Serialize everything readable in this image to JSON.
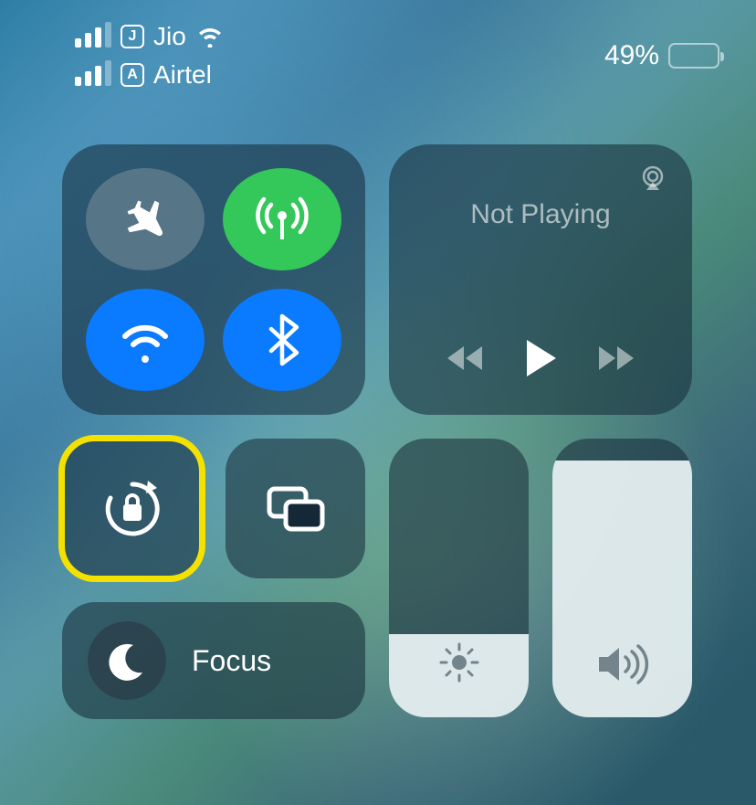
{
  "status": {
    "carriers": [
      {
        "badge": "J",
        "name": "Jio",
        "bars": 3,
        "wifi": true
      },
      {
        "badge": "A",
        "name": "Airtel",
        "bars": 3,
        "wifi": false
      }
    ],
    "battery_percent": "49%",
    "battery_level": 0.49
  },
  "connectivity": {
    "airplane_on": false,
    "cellular_on": true,
    "wifi_on": true,
    "bluetooth_on": true
  },
  "media": {
    "status": "Not Playing"
  },
  "focus": {
    "label": "Focus"
  },
  "brightness": {
    "level": 0.3
  },
  "volume": {
    "level": 0.92
  },
  "colors": {
    "active_green": "#34c759",
    "active_blue": "#0a7aff",
    "highlight": "#f5e100"
  }
}
